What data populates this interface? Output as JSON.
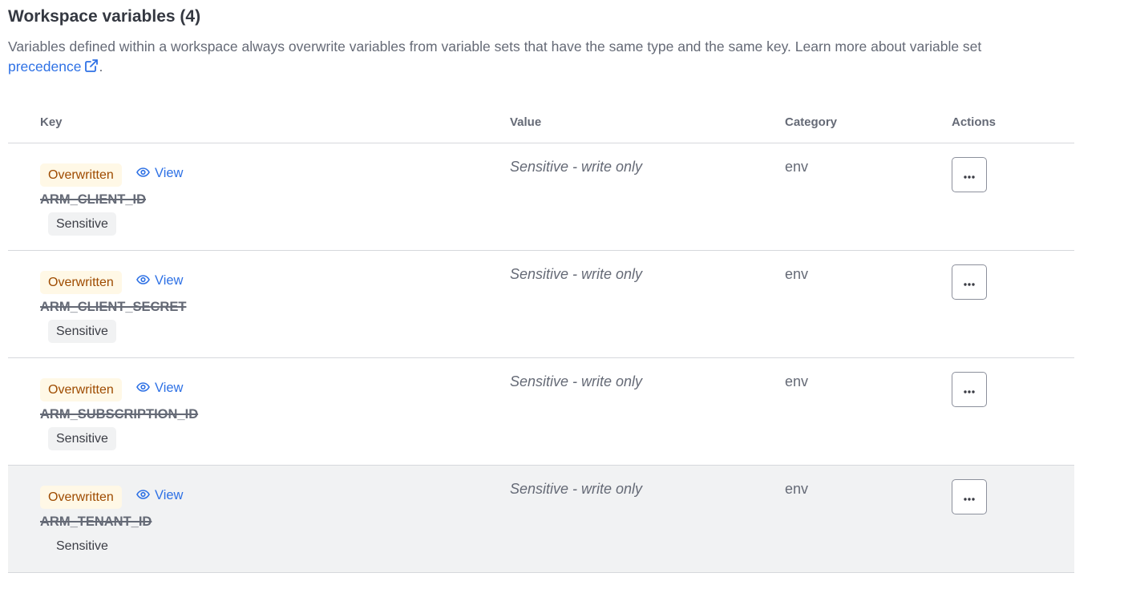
{
  "section": {
    "title": "Workspace variables (4)",
    "description": "Variables defined within a workspace always overwrite variables from variable sets that have the same type and the same key. Learn more about variable set",
    "link_label": "precedence",
    "link_suffix": "."
  },
  "table": {
    "headers": {
      "key": "Key",
      "value": "Value",
      "category": "Category",
      "actions": "Actions"
    },
    "rows": [
      {
        "status": "Overwritten",
        "view": "View",
        "key": "ARM_CLIENT_ID",
        "sensitive": "Sensitive",
        "value": "Sensitive - write only",
        "category": "env"
      },
      {
        "status": "Overwritten",
        "view": "View",
        "key": "ARM_CLIENT_SECRET",
        "sensitive": "Sensitive",
        "value": "Sensitive - write only",
        "category": "env"
      },
      {
        "status": "Overwritten",
        "view": "View",
        "key": "ARM_SUBSCRIPTION_ID",
        "sensitive": "Sensitive",
        "value": "Sensitive - write only",
        "category": "env"
      },
      {
        "status": "Overwritten",
        "view": "View",
        "key": "ARM_TENANT_ID",
        "sensitive": "Sensitive",
        "value": "Sensitive - write only",
        "category": "env"
      }
    ]
  },
  "icons": {
    "external_link": "external-link-icon",
    "view": "eye-icon",
    "actions": "more-horizontal-icon"
  },
  "colors": {
    "link": "#2e71e5",
    "overwritten_bg": "#fff8e6",
    "overwritten_text": "#9e4b00",
    "row_hover_bg": "#f1f2f3"
  }
}
